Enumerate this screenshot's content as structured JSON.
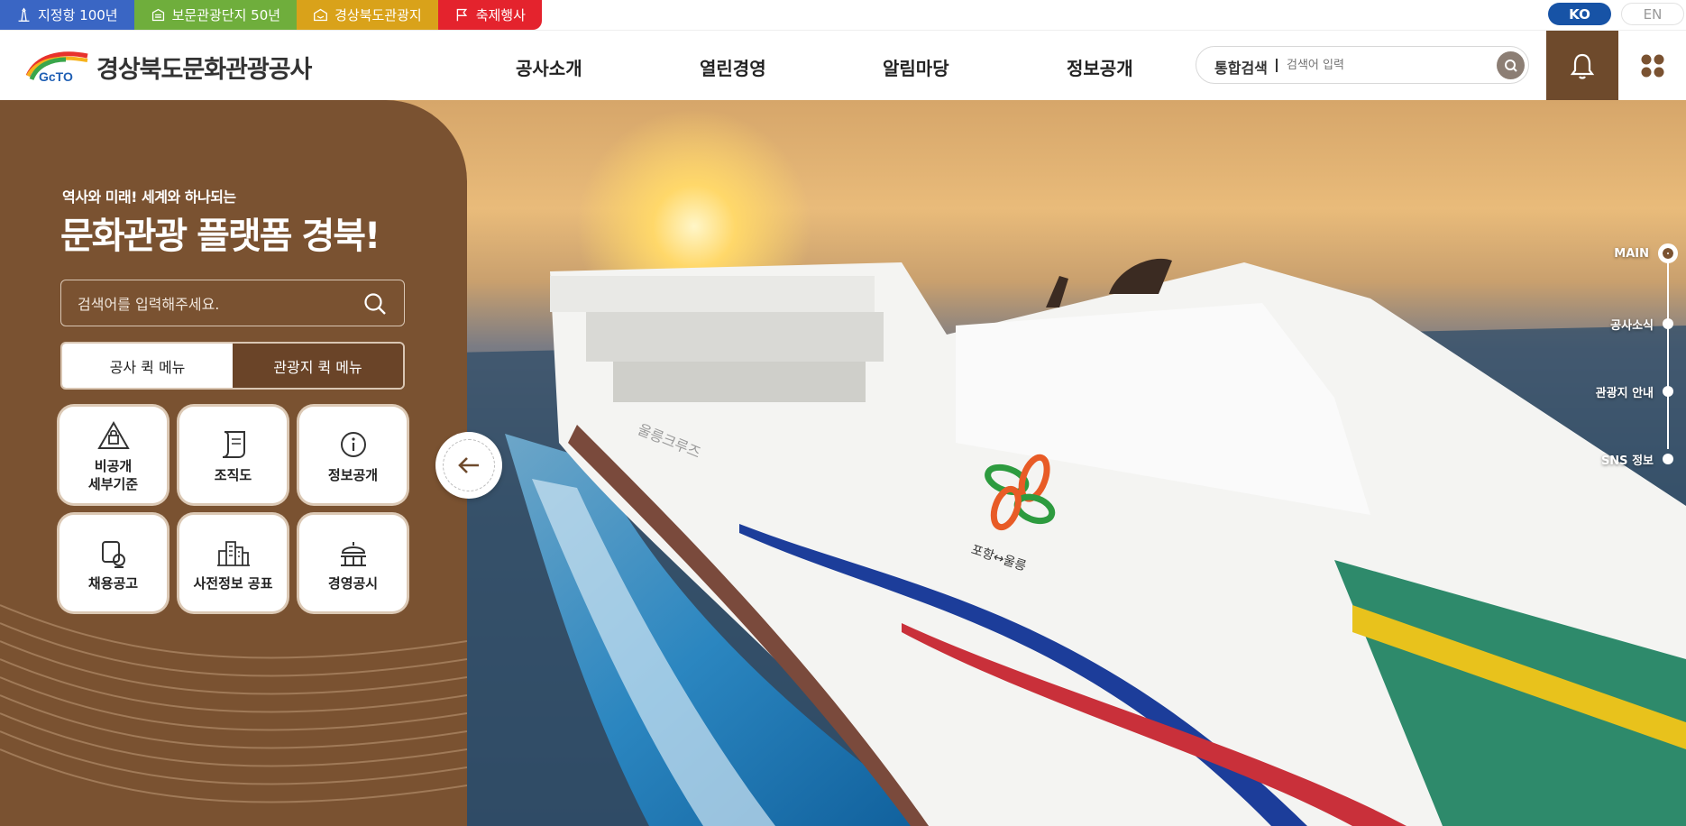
{
  "top_tabs": [
    {
      "label": "지정항 100년",
      "color": "#3a66c4",
      "icon": "lighthouse-icon"
    },
    {
      "label": "보문관광단지 50년",
      "color": "#6fae3c",
      "icon": "building-icon"
    },
    {
      "label": "경상북도관광지",
      "color": "#d9a21a",
      "icon": "map-tag-icon"
    },
    {
      "label": "축제행사",
      "color": "#e4232d",
      "icon": "flag-icon"
    }
  ],
  "language": {
    "ko": "KO",
    "en": "EN"
  },
  "header": {
    "logo_mark": "GcTO",
    "logo_name": "경상북도문화관광공사",
    "nav": [
      "공사소개",
      "열린경영",
      "알림마당",
      "정보공개"
    ],
    "search_label": "통합검색",
    "search_placeholder": "검색어 입력"
  },
  "hero": {
    "subtitle": "역사와 미래! 세계와 하나되는",
    "title": "문화관광 플랫폼 경북!",
    "search_placeholder": "검색어를 입력해주세요.",
    "quick_tabs": [
      "공사 퀵 메뉴",
      "관광지 퀵 메뉴"
    ],
    "quick_menu": [
      {
        "label": "비공개\n세부기준",
        "icon": "lock-house-icon"
      },
      {
        "label": "조직도",
        "icon": "document-scroll-icon"
      },
      {
        "label": "정보공개",
        "icon": "info-icon"
      },
      {
        "label": "채용공고",
        "icon": "recruit-icon"
      },
      {
        "label": "사전정보 공표",
        "icon": "city-buildings-icon"
      },
      {
        "label": "경영공시",
        "icon": "government-building-icon"
      }
    ],
    "ship_text_hull": "울릉크루즈",
    "ship_text_logo": "포항↔울릉"
  },
  "side_nav": [
    {
      "label": "MAIN",
      "active": true
    },
    {
      "label": "공사소식",
      "active": false
    },
    {
      "label": "관광지 안내",
      "active": false
    },
    {
      "label": "SNS 정보",
      "active": false
    }
  ],
  "colors": {
    "brand_brown": "#7a5231",
    "ko_blue": "#1753a6"
  }
}
